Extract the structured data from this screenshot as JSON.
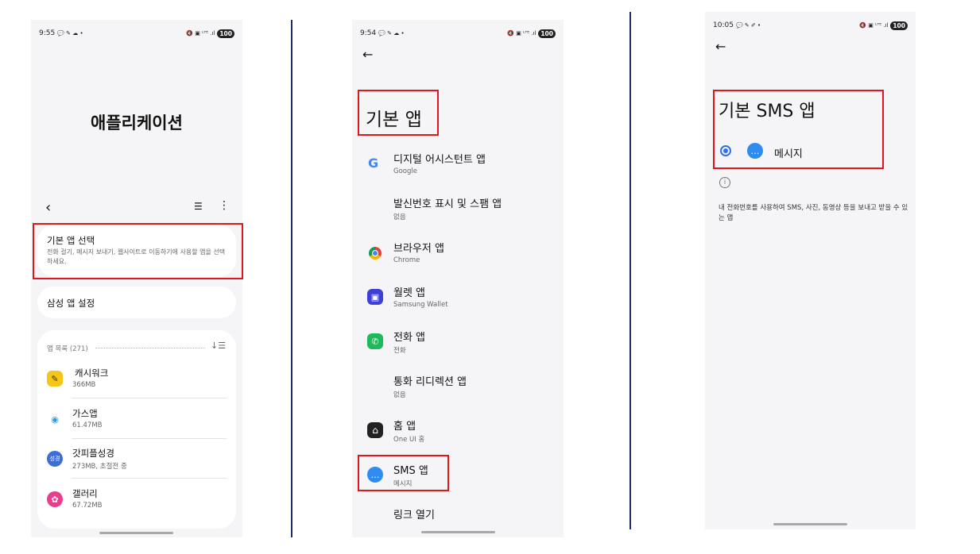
{
  "screen1": {
    "status": {
      "time": "9:55",
      "left_icons": "💬 ✎ ☁ •",
      "right_icons": "🔇 ▣ ᴸᵀᴱ .ıl",
      "battery": "100"
    },
    "page_title": "애플리케이션",
    "default_apps": {
      "title": "기본 앱 선택",
      "desc": "전화 걸기, 메시지 보내기, 웹사이트로 이동하기에 사용할 앱을 선택하세요."
    },
    "samsung_settings": "삼성 앱 설정",
    "app_list_header": "앱 목록 (271)",
    "apps": [
      {
        "name": "캐시워크",
        "size": "366MB",
        "color": "#f5c518",
        "glyph": "✎"
      },
      {
        "name": "가스앱",
        "size": "61.47MB",
        "color": "#2a9de0",
        "glyph": "◉"
      },
      {
        "name": "갓피플성경",
        "size": "273MB, 초절전 중",
        "color": "#3b6fd8",
        "glyph": "성경"
      },
      {
        "name": "갤러리",
        "size": "67.72MB",
        "color": "#e83e8c",
        "glyph": "✿"
      }
    ]
  },
  "screen2": {
    "status": {
      "time": "9:54",
      "left_icons": "💬 ✎ ☁ •",
      "right_icons": "🔇 ▣ ᴸᵀᴱ .ıl",
      "battery": "100"
    },
    "page_title": "기본 앱",
    "items": [
      {
        "title": "디지털 어시스턴트 앱",
        "sub": "Google",
        "icon": "G",
        "color": "#4285f4"
      },
      {
        "title": "발신번호 표시 및 스팸 앱",
        "sub": "없음",
        "icon": "",
        "color": ""
      },
      {
        "title": "브라우저 앱",
        "sub": "Chrome",
        "icon": "●",
        "color": "#db4437"
      },
      {
        "title": "월렛 앱",
        "sub": "Samsung Wallet",
        "icon": "▣",
        "color": "#3d3fd9"
      },
      {
        "title": "전화 앱",
        "sub": "전화",
        "icon": "✆",
        "color": "#1fb85a"
      },
      {
        "title": "통화 리디렉션 앱",
        "sub": "없음",
        "icon": "",
        "color": ""
      },
      {
        "title": "홈 앱",
        "sub": "One UI 홈",
        "icon": "⌂",
        "color": "#222222"
      },
      {
        "title": "SMS 앱",
        "sub": "메시지",
        "icon": "…",
        "color": "#2e8cf0"
      },
      {
        "title": "링크 열기",
        "sub": "",
        "icon": "",
        "color": ""
      }
    ]
  },
  "screen3": {
    "status": {
      "time": "10:05",
      "left_icons": "💬 ✎ ✐ •",
      "right_icons": "🔇 ▣ ᴸᵀᴱ .ıl",
      "battery": "100"
    },
    "page_title": "기본 SMS 앱",
    "option": "메시지",
    "info": "내 전화번호를 사용하여 SMS, 사진, 동영상 등을 보내고 받을 수 있는 앱"
  }
}
